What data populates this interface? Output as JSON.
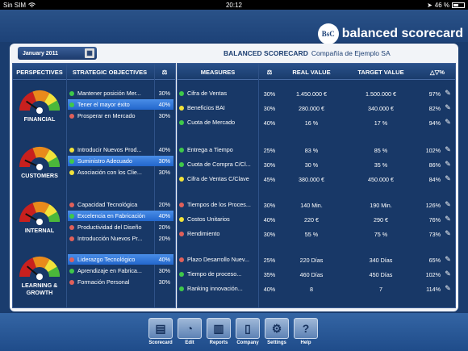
{
  "status": {
    "carrier": "Sin SIM",
    "time": "20:12",
    "battery": "46 %",
    "battery_level": 0.46
  },
  "brand": {
    "logo_text": "BsC",
    "name": "balanced scorecard"
  },
  "date_label": "January 2011",
  "header": {
    "title": "BALANCED SCORECARD",
    "company": "Compañía de Ejemplo SA"
  },
  "left_headers": {
    "perspectives": "PERSPECTIVES",
    "objectives": "STRATEGIC OBJECTIVES"
  },
  "right_headers": {
    "measures": "MEASURES",
    "real": "REAL VALUE",
    "target": "TARGET VALUE",
    "pct": "△▽%"
  },
  "perspectives": [
    {
      "label": "FINANCIAL",
      "objectives": [
        {
          "name": "Mantener posición Mer...",
          "pct": "30%",
          "status": "green",
          "selected": false
        },
        {
          "name": "Tener el mayor éxito",
          "pct": "40%",
          "status": "green",
          "selected": true
        },
        {
          "name": "Prosperar en Mercado",
          "pct": "30%",
          "status": "red",
          "selected": false
        }
      ],
      "measures": [
        {
          "name": "Cifra de Ventas",
          "weight": "30%",
          "real": "1.450.000 €",
          "target": "1.500.000 €",
          "pct": "97%",
          "status": "green"
        },
        {
          "name": "Beneficios BAI",
          "weight": "30%",
          "real": "280.000 €",
          "target": "340.000 €",
          "pct": "82%",
          "status": "yellow"
        },
        {
          "name": "Cuota de Mercado",
          "weight": "40%",
          "real": "16 %",
          "target": "17 %",
          "pct": "94%",
          "status": "green"
        }
      ]
    },
    {
      "label": "CUSTOMERS",
      "objectives": [
        {
          "name": "Introducir Nuevos Prod...",
          "pct": "40%",
          "status": "yellow",
          "selected": false
        },
        {
          "name": "Suministro Adecuado",
          "pct": "30%",
          "status": "green",
          "selected": true
        },
        {
          "name": "Asociación con los Clie...",
          "pct": "30%",
          "status": "yellow",
          "selected": false
        }
      ],
      "measures": [
        {
          "name": "Entrega a Tiempo",
          "weight": "25%",
          "real": "83 %",
          "target": "85 %",
          "pct": "102%",
          "status": "green"
        },
        {
          "name": "Cuota de Compra C/Cl...",
          "weight": "30%",
          "real": "30 %",
          "target": "35 %",
          "pct": "86%",
          "status": "green"
        },
        {
          "name": "Cifra de Ventas C/Clave",
          "weight": "45%",
          "real": "380.000 €",
          "target": "450.000 €",
          "pct": "84%",
          "status": "yellow"
        }
      ]
    },
    {
      "label": "INTERNAL",
      "objectives": [
        {
          "name": "Capacidad Tecnológica",
          "pct": "20%",
          "status": "red",
          "selected": false
        },
        {
          "name": "Excelencia en Fabricación",
          "pct": "40%",
          "status": "green",
          "selected": true
        },
        {
          "name": "Productividad del Diseño",
          "pct": "20%",
          "status": "red",
          "selected": false
        },
        {
          "name": "Introducción Nuevos Pr...",
          "pct": "20%",
          "status": "red",
          "selected": false
        }
      ],
      "measures": [
        {
          "name": "Tiempos de los Proces...",
          "weight": "30%",
          "real": "140 Min.",
          "target": "190 Min.",
          "pct": "126%",
          "status": "red"
        },
        {
          "name": "Costos Unitarios",
          "weight": "40%",
          "real": "220 €",
          "target": "290 €",
          "pct": "76%",
          "status": "yellow"
        },
        {
          "name": "Rendimiento",
          "weight": "30%",
          "real": "55 %",
          "target": "75 %",
          "pct": "73%",
          "status": "red"
        }
      ]
    },
    {
      "label": "LEARNING & GROWTH",
      "objectives": [
        {
          "name": "Liderazgo Tecnológico",
          "pct": "40%",
          "status": "red",
          "selected": true
        },
        {
          "name": "Aprendizaje en Fabrica...",
          "pct": "30%",
          "status": "green",
          "selected": false
        },
        {
          "name": "Formación Personal",
          "pct": "30%",
          "status": "red",
          "selected": false
        }
      ],
      "measures": [
        {
          "name": "Plazo Desarrollo Nuev...",
          "weight": "25%",
          "real": "220 Días",
          "target": "340 Días",
          "pct": "65%",
          "status": "red"
        },
        {
          "name": "Tiempo de proceso...",
          "weight": "35%",
          "real": "460 Días",
          "target": "450 Días",
          "pct": "102%",
          "status": "green"
        },
        {
          "name": "Ranking innovación...",
          "weight": "40%",
          "real": "8",
          "target": "7",
          "pct": "114%",
          "status": "green"
        }
      ]
    }
  ],
  "toolbar": [
    {
      "label": "Scorecard",
      "icon": "scorecard-icon"
    },
    {
      "label": "Edit",
      "icon": "gauge-icon"
    },
    {
      "label": "Reports",
      "icon": "bar-chart-icon"
    },
    {
      "label": "Company",
      "icon": "building-icon"
    },
    {
      "label": "Settings",
      "icon": "gears-icon"
    },
    {
      "label": "Help",
      "icon": "question-icon"
    }
  ],
  "colors": {
    "green": "#3fc84a",
    "yellow": "#f2e23a",
    "red": "#e0605a",
    "accent": "#2266cc"
  }
}
